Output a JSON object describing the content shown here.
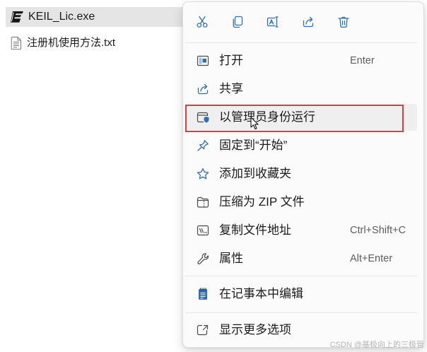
{
  "explorer": {
    "files": [
      {
        "name": "KEIL_Lic.exe",
        "icon": "keil-exe-icon",
        "selected": true
      },
      {
        "name": "注册机使用方法.txt",
        "icon": "text-file-icon",
        "selected": false
      }
    ]
  },
  "context_menu": {
    "quick_actions": [
      "scissors-icon",
      "copy-icon",
      "rename-icon",
      "share-icon",
      "trash-icon"
    ],
    "items": [
      {
        "label": "打开",
        "shortcut": "Enter",
        "icon": "open-icon"
      },
      {
        "label": "共享",
        "icon": "share-icon"
      },
      {
        "label": "以管理员身份运行",
        "icon": "admin-shield-icon",
        "hovered": true
      },
      {
        "label": "固定到“开始”",
        "icon": "pin-icon"
      },
      {
        "label": "添加到收藏夹",
        "icon": "star-icon"
      },
      {
        "label": "压缩为 ZIP 文件",
        "icon": "zip-folder-icon"
      },
      {
        "label": "复制文件地址",
        "shortcut": "Ctrl+Shift+C",
        "icon": "copy-path-icon"
      },
      {
        "label": "属性",
        "shortcut": "Alt+Enter",
        "icon": "wrench-icon"
      }
    ],
    "edit_item": {
      "label": "在记事本中编辑",
      "icon": "notepad-icon"
    },
    "more_item": {
      "label": "显示更多选项",
      "icon": "show-more-icon"
    }
  },
  "watermark": "CSDN @基极向上的三极管",
  "colors": {
    "accent": "#2f6db5",
    "icon_gray": "#4a4a4a",
    "selection_bg": "#e5e5e5",
    "hover_bg": "#efefef",
    "annotation_red": "#e23b3b",
    "menu_bg": "#fbfbfb"
  }
}
